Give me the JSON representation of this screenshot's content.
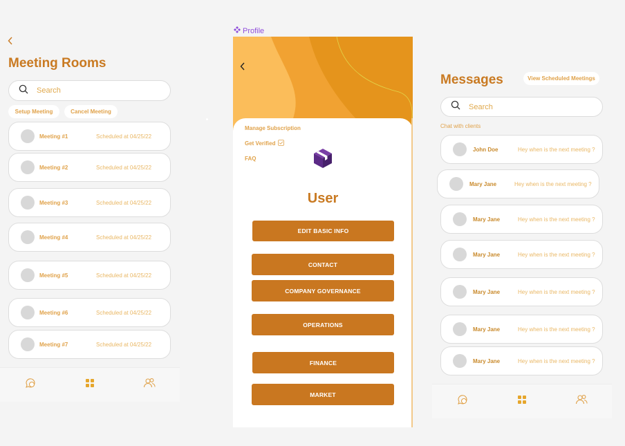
{
  "meeting_rooms": {
    "back_icon": "chevron-left-icon",
    "title": "Meeting Rooms",
    "search_placeholder": "Search",
    "actions": [
      "Setup Meeting",
      "Cancel Meeting"
    ],
    "meetings": [
      {
        "name": "Meeting #1",
        "time": "Scheduled at 04/25/22"
      },
      {
        "name": "Meeting #2",
        "time": "Scheduled at 04/25/22"
      },
      {
        "name": "Meeting #3",
        "time": "Scheduled at 04/25/22"
      },
      {
        "name": "Meeting #4",
        "time": "Scheduled at 04/25/22"
      },
      {
        "name": "Meeting #5",
        "time": "Scheduled at 04/25/22"
      },
      {
        "name": "Meeting #6",
        "time": "Scheduled at 04/25/22"
      },
      {
        "name": "Meeting #7",
        "time": "Scheduled at 04/25/22"
      }
    ]
  },
  "profile": {
    "frame_label": "Profile",
    "pills": [
      "Manage Subscription",
      "Get Verified",
      "FAQ"
    ],
    "user_name": "User",
    "buttons": [
      "EDIT BASIC INFO",
      "CONTACT",
      "COMPANY GOVERNANCE",
      "OPERATIONS",
      "FINANCE",
      "MARKET"
    ]
  },
  "messages": {
    "title": "Messages",
    "scheduled_button": "View Scheduled Meetings",
    "search_placeholder": "Search",
    "section_label": "Chat with clients",
    "chats": [
      {
        "name": "John Doe",
        "message": "Hey when is the next meeting ?"
      },
      {
        "name": "Mary Jane",
        "message": "Hey when is the next meeting ?"
      },
      {
        "name": "Mary Jane",
        "message": "Hey when is the next meeting ?"
      },
      {
        "name": "Mary Jane",
        "message": "Hey when is the next meeting ?"
      },
      {
        "name": "Mary Jane",
        "message": "Hey when is the next meeting ?"
      },
      {
        "name": "Mary Jane",
        "message": "Hey when is the next meeting ?"
      },
      {
        "name": "Mary Jane",
        "message": "Hey when is the next meeting ?"
      }
    ]
  },
  "nav_icons": [
    "chat-icon",
    "grid-icon",
    "users-icon"
  ],
  "colors": {
    "brand": "#c97a22",
    "accent_light": "#e0a24a",
    "button": "#c97720",
    "header_orange": "#f1a232",
    "frame_label": "#8f4edb",
    "logo": "#5b2a86"
  }
}
